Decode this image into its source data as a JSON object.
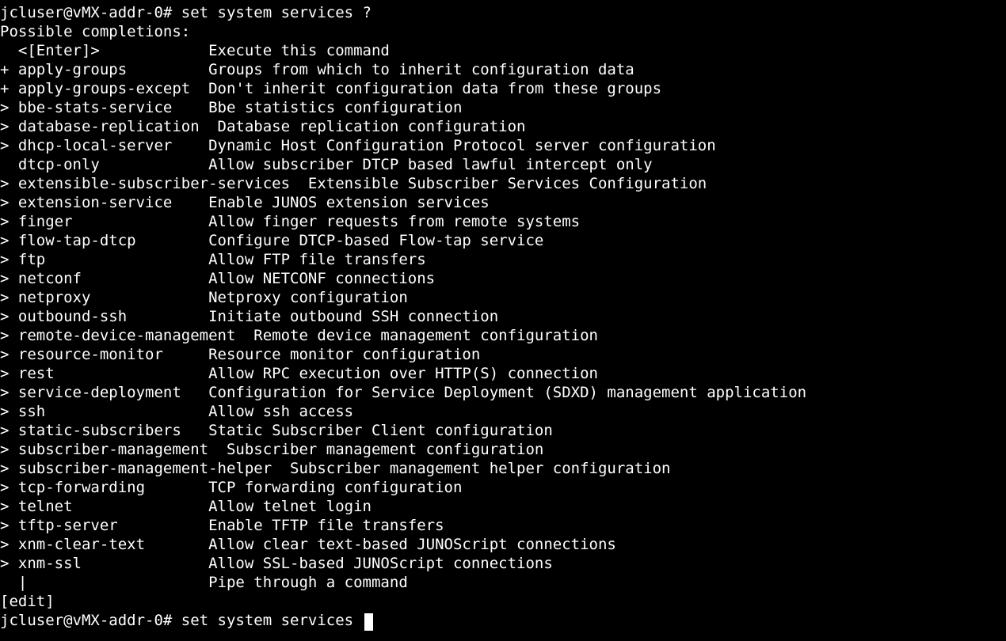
{
  "prompt1": "jcluser@vMX-addr-0# set system services ?",
  "header": "Possible completions:",
  "completions": [
    {
      "marker": " ",
      "name": "<[Enter]>",
      "desc": "Execute this command"
    },
    {
      "marker": "+",
      "name": "apply-groups",
      "desc": "Groups from which to inherit configuration data"
    },
    {
      "marker": "+",
      "name": "apply-groups-except",
      "desc": "Don't inherit configuration data from these groups"
    },
    {
      "marker": ">",
      "name": "bbe-stats-service",
      "desc": "Bbe statistics configuration"
    },
    {
      "marker": ">",
      "name": "database-replication",
      "desc": "Database replication configuration"
    },
    {
      "marker": ">",
      "name": "dhcp-local-server",
      "desc": "Dynamic Host Configuration Protocol server configuration"
    },
    {
      "marker": " ",
      "name": "dtcp-only",
      "desc": "Allow subscriber DTCP based lawful intercept only"
    },
    {
      "marker": ">",
      "name": "extensible-subscriber-services",
      "desc": "Extensible Subscriber Services Configuration"
    },
    {
      "marker": ">",
      "name": "extension-service",
      "desc": "Enable JUNOS extension services"
    },
    {
      "marker": ">",
      "name": "finger",
      "desc": "Allow finger requests from remote systems"
    },
    {
      "marker": ">",
      "name": "flow-tap-dtcp",
      "desc": "Configure DTCP-based Flow-tap service"
    },
    {
      "marker": ">",
      "name": "ftp",
      "desc": "Allow FTP file transfers"
    },
    {
      "marker": ">",
      "name": "netconf",
      "desc": "Allow NETCONF connections"
    },
    {
      "marker": ">",
      "name": "netproxy",
      "desc": "Netproxy configuration"
    },
    {
      "marker": ">",
      "name": "outbound-ssh",
      "desc": "Initiate outbound SSH connection"
    },
    {
      "marker": ">",
      "name": "remote-device-management",
      "desc": "Remote device management configuration"
    },
    {
      "marker": ">",
      "name": "resource-monitor",
      "desc": "Resource monitor configuration"
    },
    {
      "marker": ">",
      "name": "rest",
      "desc": "Allow RPC execution over HTTP(S) connection"
    },
    {
      "marker": ">",
      "name": "service-deployment",
      "desc": "Configuration for Service Deployment (SDXD) management application"
    },
    {
      "marker": ">",
      "name": "ssh",
      "desc": "Allow ssh access"
    },
    {
      "marker": ">",
      "name": "static-subscribers",
      "desc": "Static Subscriber Client configuration"
    },
    {
      "marker": ">",
      "name": "subscriber-management",
      "desc": "Subscriber management configuration"
    },
    {
      "marker": ">",
      "name": "subscriber-management-helper",
      "desc": "Subscriber management helper configuration"
    },
    {
      "marker": ">",
      "name": "tcp-forwarding",
      "desc": "TCP forwarding configuration"
    },
    {
      "marker": ">",
      "name": "telnet",
      "desc": "Allow telnet login"
    },
    {
      "marker": ">",
      "name": "tftp-server",
      "desc": "Enable TFTP file transfers"
    },
    {
      "marker": ">",
      "name": "xnm-clear-text",
      "desc": "Allow clear text-based JUNOScript connections"
    },
    {
      "marker": ">",
      "name": "xnm-ssl",
      "desc": "Allow SSL-based JUNOScript connections"
    },
    {
      "marker": " ",
      "name": "|",
      "desc": "Pipe through a command"
    }
  ],
  "mode": "[edit]",
  "prompt2": "jcluser@vMX-addr-0# set system services ",
  "layout": {
    "name_col": 23
  }
}
